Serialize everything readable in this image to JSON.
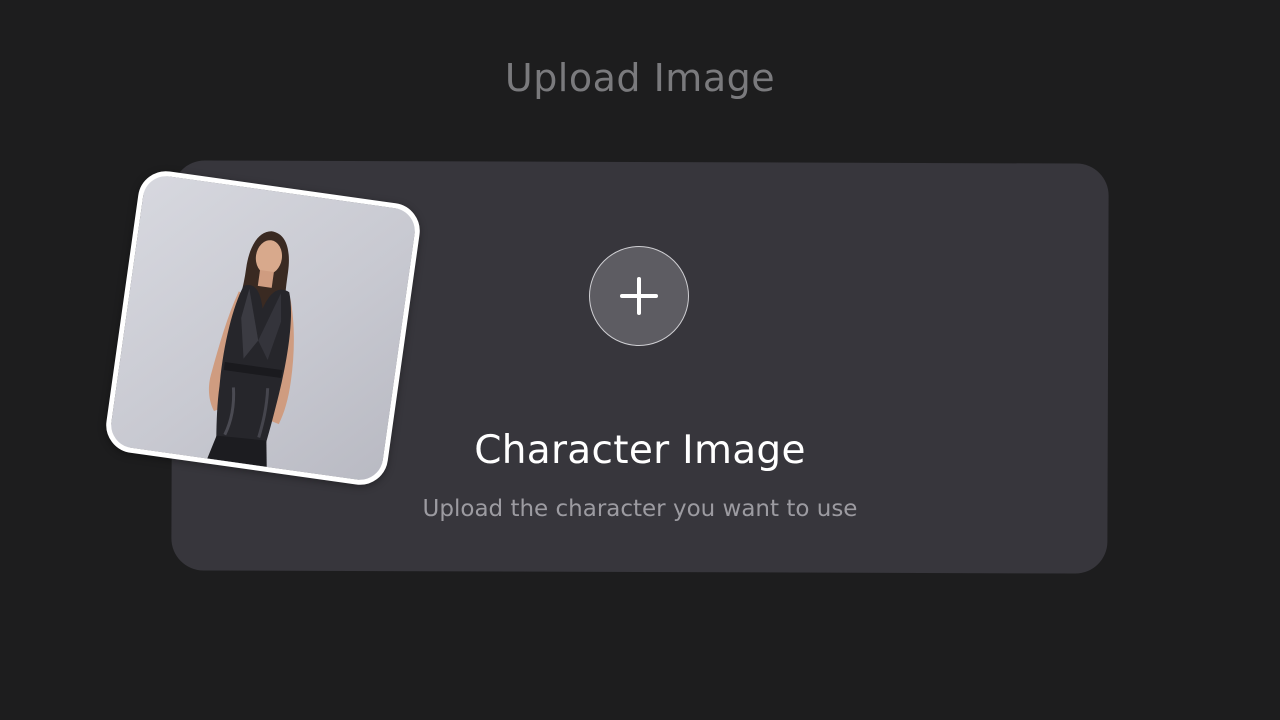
{
  "page": {
    "title": "Upload Image"
  },
  "upload_card": {
    "title": "Character Image",
    "subtitle": "Upload the character you want to use",
    "add_icon": "plus-icon"
  },
  "example_image": {
    "icon": "example-character-photo"
  },
  "colors": {
    "background": "#1d1d1e",
    "card": "#37363c",
    "add_button": "#5d5c62",
    "title_muted": "#7a7a7d",
    "subtitle": "#9c9ba1"
  }
}
